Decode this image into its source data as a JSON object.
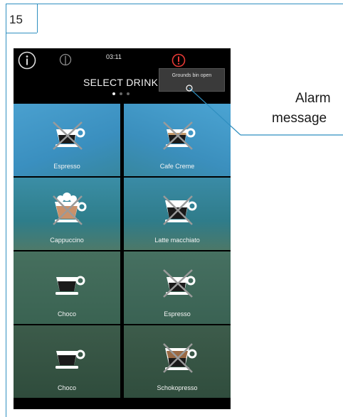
{
  "figure": {
    "number": "15"
  },
  "status_bar": {
    "time": "03:11",
    "icons": {
      "info": "info-icon",
      "clock": "clock-icon",
      "alarm": "alarm-icon"
    },
    "alarm_color": "#e53935"
  },
  "header": {
    "title": "SELECT DRINK",
    "page_count": 3,
    "active_page": 1
  },
  "tooltip": {
    "text": "Grounds bin open"
  },
  "drinks": [
    {
      "label": "Espresso",
      "icon": "espresso-disabled-icon"
    },
    {
      "label": "Cafe Creme",
      "icon": "cafe-creme-disabled-icon"
    },
    {
      "label": "Cappuccino",
      "icon": "cappuccino-disabled-icon"
    },
    {
      "label": "Latte macchiato",
      "icon": "latte-macchiato-disabled-icon"
    },
    {
      "label": "Choco",
      "icon": "choco-icon"
    },
    {
      "label": "Espresso",
      "icon": "espresso-disabled-icon"
    },
    {
      "label": "Choco",
      "icon": "choco-icon"
    },
    {
      "label": "Schokopresso",
      "icon": "schokopresso-disabled-icon"
    }
  ],
  "callout": {
    "line1": "Alarm",
    "line2": "message",
    "color": "#2f8fc0"
  }
}
